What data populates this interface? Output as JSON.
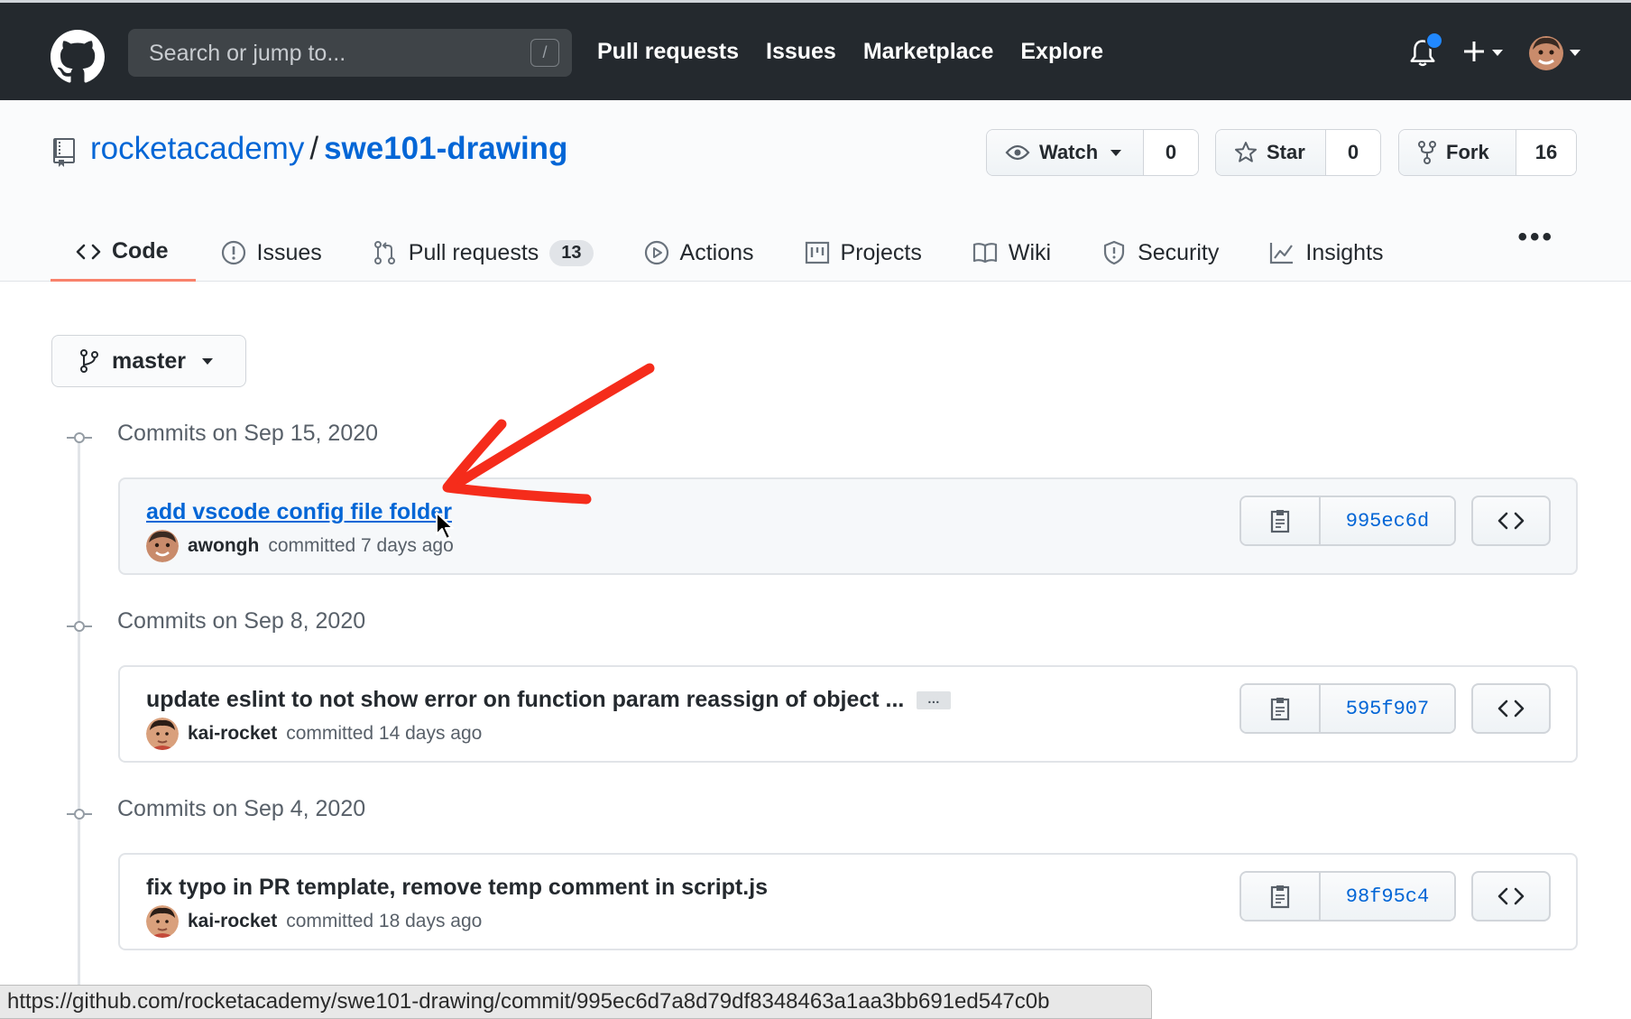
{
  "header": {
    "search_placeholder": "Search or jump to...",
    "search_shortcut": "/",
    "nav": [
      "Pull requests",
      "Issues",
      "Marketplace",
      "Explore"
    ],
    "accent": "#2188ff"
  },
  "repo": {
    "owner": "rocketacademy",
    "separator": "/",
    "name": "swe101-drawing",
    "watch_label": "Watch",
    "watch_count": "0",
    "star_label": "Star",
    "star_count": "0",
    "fork_label": "Fork",
    "fork_count": "16"
  },
  "tabs": [
    {
      "label": "Code",
      "icon": "code-icon",
      "selected": true
    },
    {
      "label": "Issues",
      "icon": "issue-icon"
    },
    {
      "label": "Pull requests",
      "icon": "pull-request-icon",
      "count": "13"
    },
    {
      "label": "Actions",
      "icon": "play-icon"
    },
    {
      "label": "Projects",
      "icon": "project-icon"
    },
    {
      "label": "Wiki",
      "icon": "book-icon"
    },
    {
      "label": "Security",
      "icon": "shield-icon"
    },
    {
      "label": "Insights",
      "icon": "graph-icon"
    }
  ],
  "tabs_more": "•••",
  "branch": "master",
  "commit_groups": [
    {
      "date": "Commits on Sep 15, 2020",
      "title": "add vscode config file folder",
      "author": "awongh",
      "when": "committed 7 days ago",
      "sha": "995ec6d"
    },
    {
      "date": "Commits on Sep 8, 2020",
      "title": "update eslint to not show error on function param reassign of object ...",
      "hidden_text": "…",
      "author": "kai-rocket",
      "when": "committed 14 days ago",
      "sha": "595f907"
    },
    {
      "date": "Commits on Sep 4, 2020",
      "title": "fix typo in PR template, remove temp comment in script.js",
      "author": "kai-rocket",
      "when": "committed 18 days ago",
      "sha": "98f95c4"
    }
  ],
  "status_url": "https://github.com/rocketacademy/swe101-drawing/commit/995ec6d7a8d79df8348463a1aa3bb691ed547c0b",
  "annotation_color": "#f52c1b"
}
